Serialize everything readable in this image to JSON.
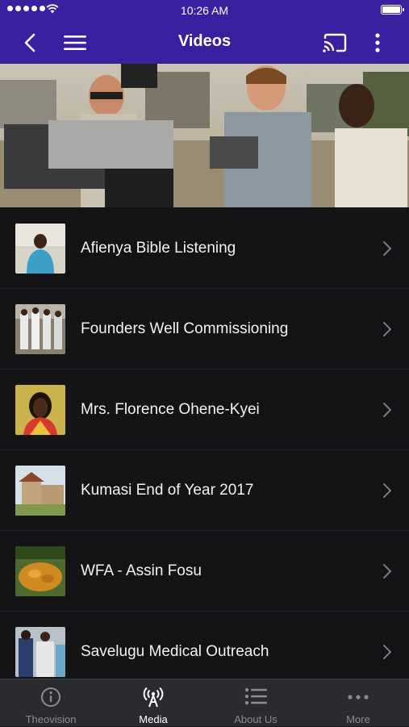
{
  "status_bar": {
    "time": "10:26 AM"
  },
  "nav": {
    "title": "Videos"
  },
  "videos": [
    {
      "title": "Afienya Bible Listening"
    },
    {
      "title": "Founders Well Commissioning"
    },
    {
      "title": "Mrs. Florence Ohene-Kyei"
    },
    {
      "title": "Kumasi End of Year 2017"
    },
    {
      "title": "WFA - Assin Fosu"
    },
    {
      "title": "Savelugu Medical Outreach"
    }
  ],
  "tabs": [
    {
      "label": "Theovision",
      "icon": "info-icon",
      "active": false
    },
    {
      "label": "Media",
      "icon": "broadcast-icon",
      "active": true
    },
    {
      "label": "About Us",
      "icon": "list-icon",
      "active": false
    },
    {
      "label": "More",
      "icon": "more-dots-icon",
      "active": false
    }
  ],
  "colors": {
    "accent": "#3a1fa0",
    "background": "#141416",
    "tabbar": "#2a2b2e"
  }
}
